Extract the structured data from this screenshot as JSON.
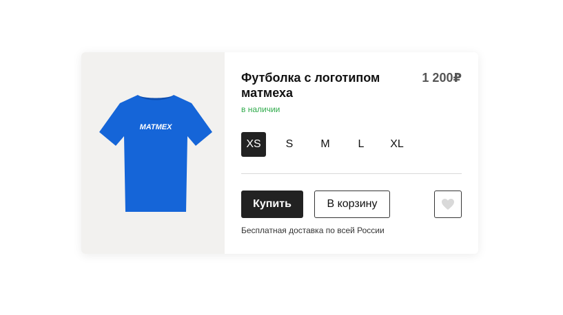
{
  "product": {
    "title": "Футболка с логотипом матмеха",
    "price": "1 200₽",
    "availability": "в наличии",
    "image_text": "MATMEX",
    "colors": {
      "shirt": "#1565d8",
      "accent_green": "#2eaa4a",
      "dark": "#222222"
    }
  },
  "sizes": {
    "items": [
      "XS",
      "S",
      "M",
      "L",
      "XL"
    ],
    "selected": "XS"
  },
  "actions": {
    "buy_label": "Купить",
    "cart_label": "В корзину",
    "favorite_icon": "heart-icon"
  },
  "delivery_note": "Бесплатная доставка по всей России"
}
